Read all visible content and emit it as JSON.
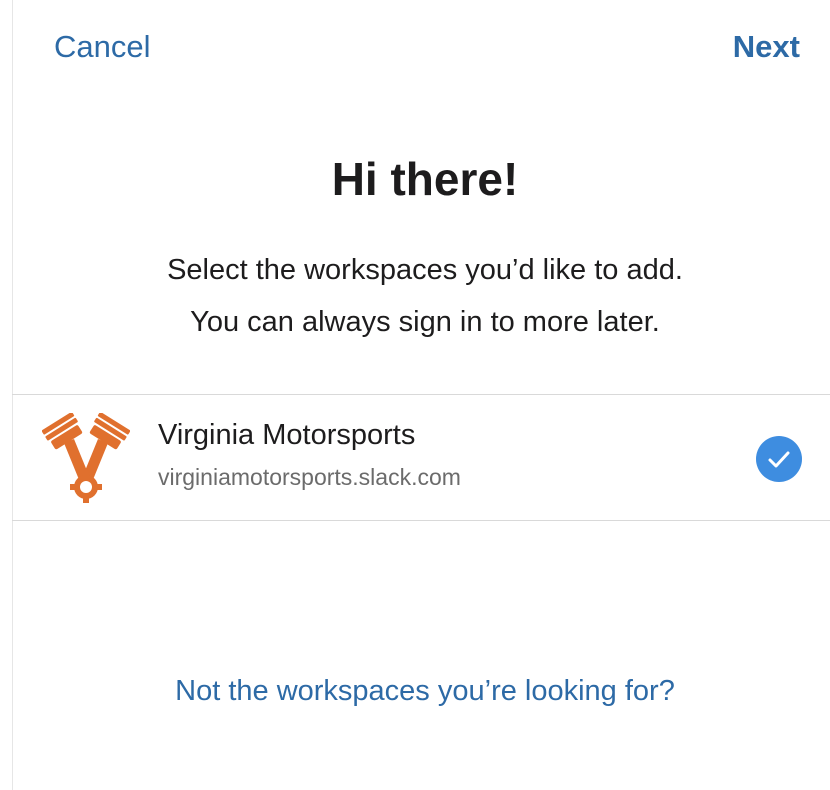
{
  "header": {
    "cancel_label": "Cancel",
    "next_label": "Next"
  },
  "intro": {
    "title": "Hi there!",
    "line1": "Select the workspaces you’d like to add.",
    "line2": "You can always sign in to more later."
  },
  "workspaces": [
    {
      "name": "Virginia Motorsports",
      "url": "virginiamotorsports.slack.com",
      "logo_icon": "crossed-pistons-icon",
      "logo_color": "#e0702e",
      "selected": true,
      "check_icon": "checkmark-circle-icon",
      "check_color": "#3e8de0"
    }
  ],
  "footer": {
    "help_link_label": "Not the workspaces you’re looking for?"
  },
  "colors": {
    "accent_link": "#2d6aa6",
    "text_primary": "#1d1c1d",
    "text_secondary": "#6b6b6b",
    "divider": "#d9d9d9"
  }
}
